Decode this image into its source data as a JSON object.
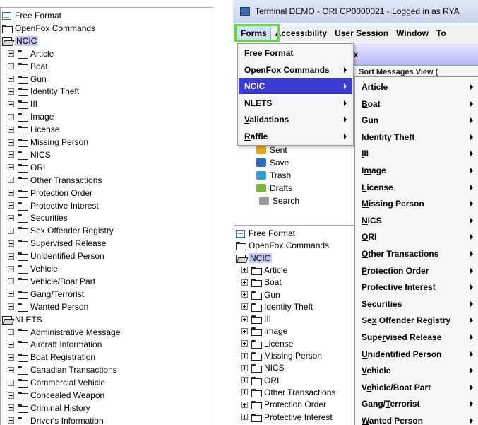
{
  "left_tree": {
    "items": [
      {
        "type": "doc",
        "label": "Free Format"
      },
      {
        "type": "folder",
        "label": "OpenFox Commands"
      },
      {
        "type": "folder-open",
        "label": "NCIC",
        "highlight": true
      },
      {
        "type": "child",
        "label": "Article"
      },
      {
        "type": "child",
        "label": "Boat"
      },
      {
        "type": "child",
        "label": "Gun"
      },
      {
        "type": "child",
        "label": "Identity Theft"
      },
      {
        "type": "child",
        "label": "III"
      },
      {
        "type": "child",
        "label": "Image"
      },
      {
        "type": "child",
        "label": "License"
      },
      {
        "type": "child",
        "label": "Missing Person"
      },
      {
        "type": "child",
        "label": "NICS"
      },
      {
        "type": "child",
        "label": "ORI"
      },
      {
        "type": "child",
        "label": "Other Transactions"
      },
      {
        "type": "child",
        "label": "Protection Order"
      },
      {
        "type": "child",
        "label": "Protective Interest"
      },
      {
        "type": "child",
        "label": "Securities"
      },
      {
        "type": "child",
        "label": "Sex Offender Registry"
      },
      {
        "type": "child",
        "label": "Supervised Release"
      },
      {
        "type": "child",
        "label": "Unidentified Person"
      },
      {
        "type": "child",
        "label": "Vehicle"
      },
      {
        "type": "child",
        "label": "Vehicle/Boat Part"
      },
      {
        "type": "child",
        "label": "Gang/Terrorist"
      },
      {
        "type": "child",
        "label": "Wanted Person"
      },
      {
        "type": "folder-open",
        "label": "NLETS"
      },
      {
        "type": "child",
        "label": "Administrative Message"
      },
      {
        "type": "child",
        "label": "Aircraft Information"
      },
      {
        "type": "child",
        "label": "Boat Registration"
      },
      {
        "type": "child",
        "label": "Canadian Transactions"
      },
      {
        "type": "child",
        "label": "Commercial Vehicle"
      },
      {
        "type": "child",
        "label": "Concealed Weapon"
      },
      {
        "type": "child",
        "label": "Criminal History"
      },
      {
        "type": "child",
        "label": "Driver's Information"
      }
    ]
  },
  "window": {
    "title": "Terminal DEMO - ORI CP0000021 - Logged in as RYA"
  },
  "menubar": {
    "items": [
      {
        "label": "Forms"
      },
      {
        "label": "Accessibility"
      },
      {
        "label": "User Session"
      },
      {
        "label": "Window"
      },
      {
        "label": "To"
      }
    ]
  },
  "background": {
    "inbox_title": "box",
    "toolbar_text": "Sort Messages   View (",
    "mail_items": [
      {
        "label": "Sent",
        "icon": "sent-icon",
        "color": "#e8a21a"
      },
      {
        "label": "Save",
        "icon": "save-icon",
        "color": "#2f6db8"
      },
      {
        "label": "Trash",
        "icon": "trash-icon",
        "color": "#2fa0d6"
      },
      {
        "label": "Drafts",
        "icon": "drafts-icon",
        "color": "#7fb341"
      },
      {
        "label": "Search",
        "icon": "search-icon",
        "color": "#9a9a9a"
      }
    ]
  },
  "mid_tree": {
    "items": [
      {
        "type": "doc",
        "label": "Free Format"
      },
      {
        "type": "folder",
        "label": "OpenFox Commands"
      },
      {
        "type": "folder-open",
        "label": "NCIC",
        "highlight": true
      },
      {
        "type": "child",
        "label": "Article"
      },
      {
        "type": "child",
        "label": "Boat"
      },
      {
        "type": "child",
        "label": "Gun"
      },
      {
        "type": "child",
        "label": "Identity Theft"
      },
      {
        "type": "child",
        "label": "III"
      },
      {
        "type": "child",
        "label": "Image"
      },
      {
        "type": "child",
        "label": "License"
      },
      {
        "type": "child",
        "label": "Missing Person"
      },
      {
        "type": "child",
        "label": "NICS"
      },
      {
        "type": "child",
        "label": "ORI"
      },
      {
        "type": "child",
        "label": "Other Transactions"
      },
      {
        "type": "child",
        "label": "Protection Order"
      },
      {
        "type": "child",
        "label": "Protective Interest"
      }
    ]
  },
  "forms_menu": {
    "items": [
      {
        "label": "Free Format",
        "submenu": false
      },
      {
        "label": "OpenFox Commands",
        "submenu": true
      },
      {
        "label": "NCIC",
        "submenu": true,
        "selected": true
      },
      {
        "label": "NLETS",
        "submenu": true
      },
      {
        "label": "Validations",
        "submenu": true
      },
      {
        "label": "Raffle",
        "submenu": true
      }
    ]
  },
  "ncic_menu": {
    "items": [
      {
        "label": "Article"
      },
      {
        "label": "Boat"
      },
      {
        "label": "Gun"
      },
      {
        "label": "Identity Theft"
      },
      {
        "label": "III"
      },
      {
        "label": "Image"
      },
      {
        "label": "License"
      },
      {
        "label": "Missing Person"
      },
      {
        "label": "NICS"
      },
      {
        "label": "ORI"
      },
      {
        "label": "Other Transactions"
      },
      {
        "label": "Protection Order"
      },
      {
        "label": "Protective Interest"
      },
      {
        "label": "Securities"
      },
      {
        "label": "Sex Offender Registry"
      },
      {
        "label": "Supervised Release"
      },
      {
        "label": "Unidentified Person"
      },
      {
        "label": "Vehicle"
      },
      {
        "label": "Vehicle/Boat Part"
      },
      {
        "label": "Gang/Terrorist"
      },
      {
        "label": "Wanted Person"
      }
    ]
  },
  "colors": {
    "selection": "#3b3bd6",
    "tree_highlight": "#c8c8f4",
    "callout": "#5ddc3a"
  }
}
